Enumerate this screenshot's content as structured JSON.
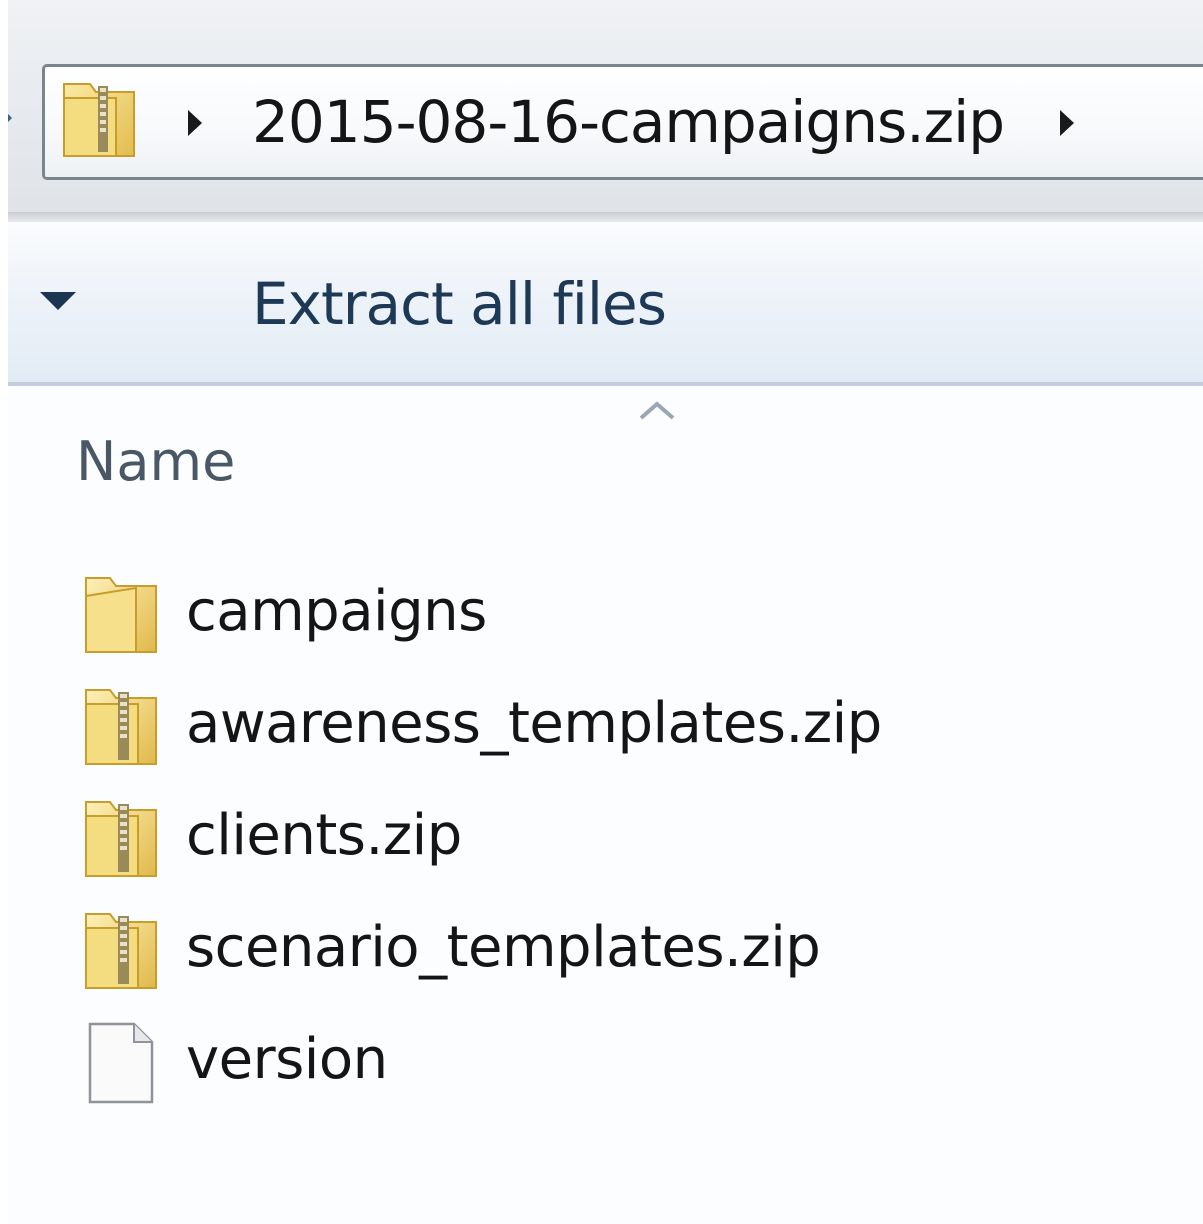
{
  "address_bar": {
    "path": "2015-08-16-campaigns.zip",
    "icon": "zip-folder-icon"
  },
  "toolbar": {
    "extract_label": "Extract all files",
    "organize_icon": "dropdown-arrow-icon"
  },
  "list_header": {
    "name_label": "Name",
    "sort_icon": "sort-ascending-icon"
  },
  "files": [
    {
      "name": "campaigns",
      "icon": "folder-icon"
    },
    {
      "name": "awareness_templates.zip",
      "icon": "zip-folder-icon"
    },
    {
      "name": "clients.zip",
      "icon": "zip-folder-icon"
    },
    {
      "name": "scenario_templates.zip",
      "icon": "zip-folder-icon"
    },
    {
      "name": "version",
      "icon": "file-icon"
    }
  ],
  "colors": {
    "folder": "#f1d46a",
    "folder_dark": "#d9b441",
    "toolbar_text": "#1e3955",
    "header_text": "#4a5766",
    "address_border": "#7b8590"
  }
}
